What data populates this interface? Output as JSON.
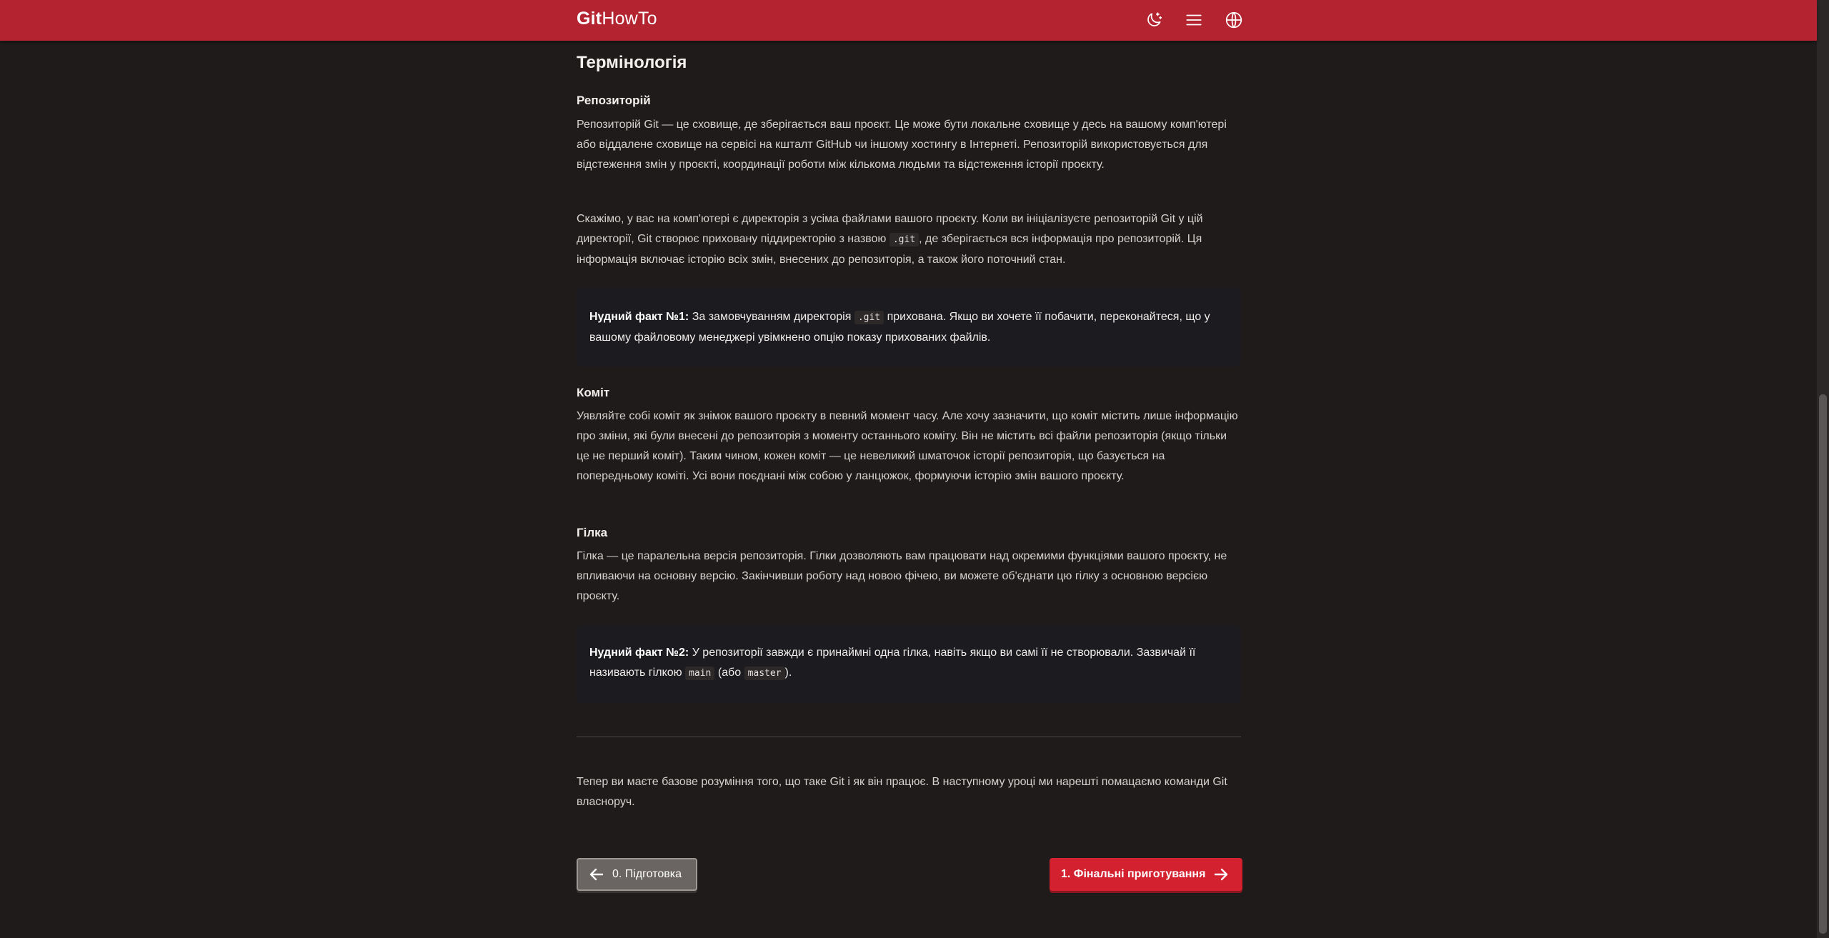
{
  "header": {
    "logo_bold": "Git",
    "logo_light": "HowTo",
    "icons": [
      "theme-toggle-icon",
      "menu-icon",
      "language-icon"
    ]
  },
  "article": {
    "section_title": "Термінологія",
    "repo_heading": "Репозиторій",
    "repo_p1": "Репозиторій Git — це сховище, де зберігається ваш проєкт. Це може бути локальне сховище у десь на вашому комп'ютері або віддалене сховище на сервісі на кшталт GitHub чи іншому хостингу в Інтернеті. Репозиторій використовується для відстеження змін у проєкті, координації роботи між кількома людьми та відстеження історії проєкту.",
    "repo_p2_a": "Скажімо, у вас на комп'ютері є директорія з усіма файлами вашого проєкту. Коли ви ініціалізуєте репозиторій Git у цій директорії, Git створює приховану піддиректорію з назвою ",
    "repo_p2_code": ".git",
    "repo_p2_b": ", де зберігається вся інформація про репозиторій. Ця інформація включає історію всіх змін, внесених до репозиторія, а також його поточний стан.",
    "fact1_label": "Нудний факт №1:",
    "fact1_a": " За замовчуванням директорія ",
    "fact1_code": ".git",
    "fact1_b": " прихована. Якщо ви хочете її побачити, переконайтеся, що у вашому файловому менеджері увімкнено опцію показу прихованих файлів.",
    "commit_heading": "Коміт",
    "commit_p": "Уявляйте собі коміт як знімок вашого проєкту в певний момент часу. Але хочу зазначити, що коміт містить лише інформацію про зміни, які були внесені до репозиторія з моменту останнього коміту. Він не містить всі файли репозиторія (якщо тільки це не перший коміт). Таким чином, кожен коміт — це невеликий шматочок історії репозиторія, що базується на попередньому коміті. Усі вони поєднані між собою у ланцюжок, формуючи історію змін вашого проєкту.",
    "branch_heading": "Гілка",
    "branch_p": "Гілка — це паралельна версія репозиторія. Гілки дозволяють вам працювати над окремими функціями вашого проєкту, не впливаючи на основну версію. Закінчивши роботу над новою фічею, ви можете об'єднати цю гілку з основною версією проєкту.",
    "fact2_label": "Нудний факт №2:",
    "fact2_a": " У репозиторії завжди є принаймні одна гілка, навіть якщо ви самі її не створювали. Зазвичай її називають гілкою ",
    "fact2_code1": "main",
    "fact2_b": " (або ",
    "fact2_code2": "master",
    "fact2_c": ").",
    "conclusion": "Тепер ви маєте базове розуміння того, що таке Git і як він працює. В наступному уроці ми нарешті помацаємо команди Git власноруч."
  },
  "navigation": {
    "prev_label": "0. Підготовка",
    "next_label": "1. Фінальні приготування"
  },
  "colors": {
    "header_bg": "#b32430",
    "page_bg": "#1f1b1a",
    "next_button": "#d4212f",
    "prev_button": "#6a6462"
  }
}
